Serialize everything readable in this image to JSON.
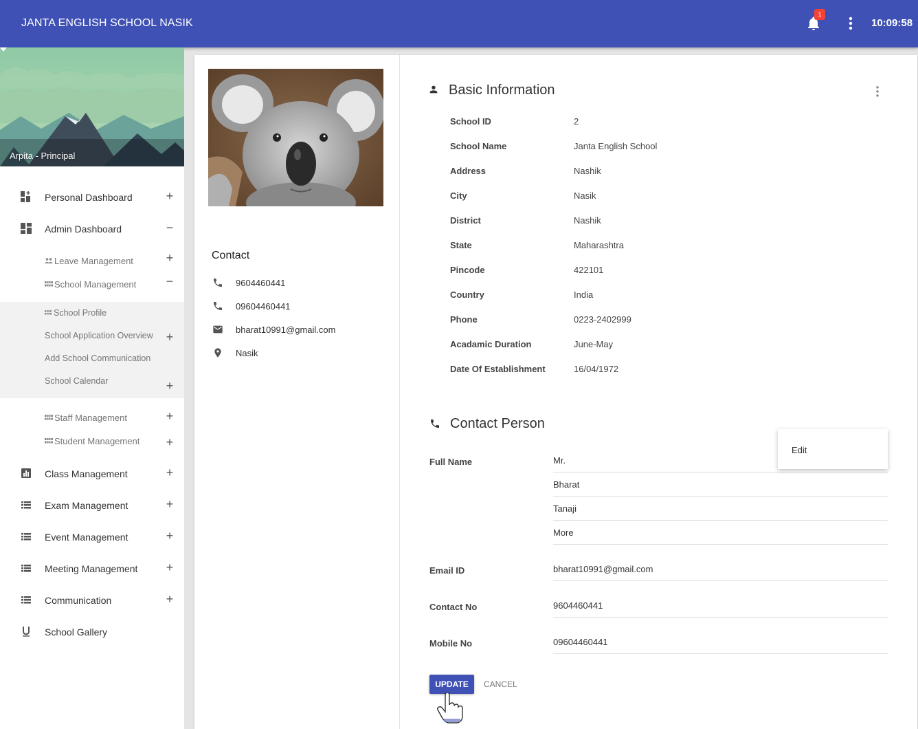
{
  "header": {
    "title": "JANTA ENGLISH SCHOOL NASIK",
    "notification_count": "1",
    "time": "10:09:58"
  },
  "sidebar": {
    "user": "Arpita - Principal",
    "items": [
      {
        "label": "Personal Dashboard",
        "toggle": "+"
      },
      {
        "label": "Admin Dashboard",
        "toggle": "−"
      },
      {
        "label": "Leave Management",
        "toggle": "+"
      },
      {
        "label": "School Management",
        "toggle": "−"
      },
      {
        "label": "School Profile"
      },
      {
        "label": "School Application Overview",
        "toggle": "+"
      },
      {
        "label": "Add School Communication"
      },
      {
        "label": "School Calendar",
        "toggle": "+"
      },
      {
        "label": "Staff Management",
        "toggle": "+"
      },
      {
        "label": "Student Management",
        "toggle": "+"
      },
      {
        "label": "Class Management",
        "toggle": "+"
      },
      {
        "label": "Exam Management",
        "toggle": "+"
      },
      {
        "label": "Event Management",
        "toggle": "+"
      },
      {
        "label": "Meeting Management",
        "toggle": "+"
      },
      {
        "label": "Communication",
        "toggle": "+"
      },
      {
        "label": "School Gallery"
      }
    ]
  },
  "contact": {
    "heading": "Contact",
    "phone1": "9604460441",
    "phone2": "09604460441",
    "email": "bharat10991@gmail.com",
    "location": "Nasik"
  },
  "basic_info": {
    "title": "Basic Information",
    "rows": [
      {
        "label": "School ID",
        "value": "2"
      },
      {
        "label": "School Name",
        "value": "Janta English School"
      },
      {
        "label": "Address",
        "value": "Nashik"
      },
      {
        "label": "City",
        "value": "Nasik"
      },
      {
        "label": "District",
        "value": "Nashik"
      },
      {
        "label": "State",
        "value": "Maharashtra"
      },
      {
        "label": "Pincode",
        "value": "422101"
      },
      {
        "label": "Country",
        "value": "India"
      },
      {
        "label": "Phone",
        "value": "0223-2402999"
      },
      {
        "label": "Acadamic Duration",
        "value": "June-May"
      },
      {
        "label": "Date Of Establishment",
        "value": "16/04/1972"
      }
    ]
  },
  "contact_person": {
    "title": "Contact Person",
    "full_name_label": "Full Name",
    "name_parts": [
      "Mr.",
      "Bharat",
      "Tanaji",
      "More"
    ],
    "email_label": "Email ID",
    "email": "bharat10991@gmail.com",
    "contact_label": "Contact No",
    "contact": "9604460441",
    "mobile_label": "Mobile No",
    "mobile": "09604460441",
    "update_label": "UPDATE",
    "cancel_label": "CANCEL"
  },
  "menu": {
    "edit_label": "Edit"
  },
  "colors": {
    "primary": "#3f51b5",
    "badge": "#f44336"
  }
}
